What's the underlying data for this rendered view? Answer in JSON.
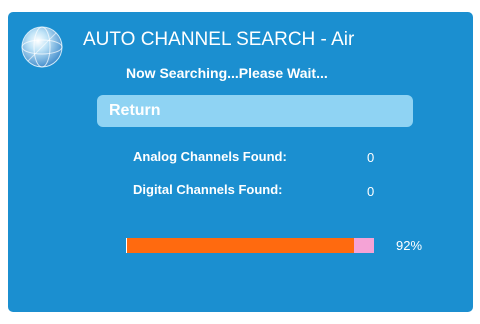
{
  "header": {
    "icon": "globe-icon",
    "title": "AUTO CHANNEL SEARCH - Air",
    "status": "Now Searching...Please Wait..."
  },
  "return_button": {
    "label": "Return"
  },
  "results": [
    {
      "label": "Analog Channels Found:",
      "value": "0"
    },
    {
      "label": "Digital Channels Found:",
      "value": "0"
    }
  ],
  "progress": {
    "percent": 92,
    "text": "92%"
  },
  "colors": {
    "background": "#1b8fd0",
    "button": "#8fd3f3",
    "progress_fill": "#ff6a0f",
    "progress_track": "#f5a3d6"
  }
}
